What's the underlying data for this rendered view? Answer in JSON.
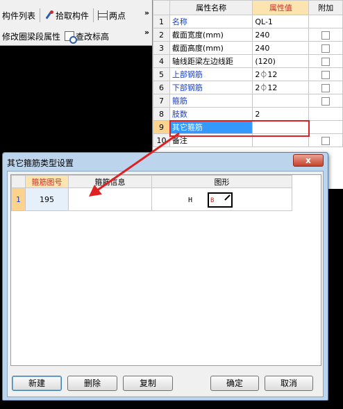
{
  "toolbar": {
    "component_list": "构件列表",
    "pick_component": "拾取构件",
    "two_points": "两点",
    "modify_ring_beam": "修改圈梁段属性",
    "query_annotation": "查改标高",
    "more": "»"
  },
  "props": {
    "headers": {
      "name": "属性名称",
      "value": "属性值",
      "extra": "附加"
    },
    "rows": [
      {
        "num": "1",
        "name": "名称",
        "value": "QL-1",
        "check": false
      },
      {
        "num": "2",
        "name": "截面宽度(mm)",
        "value": "240",
        "check": true
      },
      {
        "num": "3",
        "name": "截面高度(mm)",
        "value": "240",
        "check": true
      },
      {
        "num": "4",
        "name": "轴线距梁左边线距",
        "value": "(120)",
        "check": true
      },
      {
        "num": "5",
        "name": "上部钢筋",
        "value": "2⏀12",
        "check": true
      },
      {
        "num": "6",
        "name": "下部钢筋",
        "value": "2⏀12",
        "check": true
      },
      {
        "num": "7",
        "name": "箍筋",
        "value": "",
        "check": true
      },
      {
        "num": "8",
        "name": "肢数",
        "value": "2",
        "check": false
      },
      {
        "num": "9",
        "name": "其它箍筋",
        "value": "",
        "check": false
      },
      {
        "num": "10",
        "name": "备注",
        "value": "",
        "check": true
      }
    ]
  },
  "dialog": {
    "title": "其它箍筋类型设置",
    "close": "x",
    "headers": {
      "code": "箍筋图号",
      "info": "箍筋信息",
      "shape": "图形"
    },
    "rows": [
      {
        "num": "1",
        "code": "195",
        "info": "",
        "shape_h": "H",
        "shape_b": "B"
      }
    ],
    "buttons": {
      "new": "新建",
      "delete": "删除",
      "copy": "复制",
      "ok": "确定",
      "cancel": "取消"
    }
  },
  "colors": {
    "highlight_red": "#e02020",
    "selection_blue": "#3399ff",
    "header_orange": "#fce4b0"
  }
}
